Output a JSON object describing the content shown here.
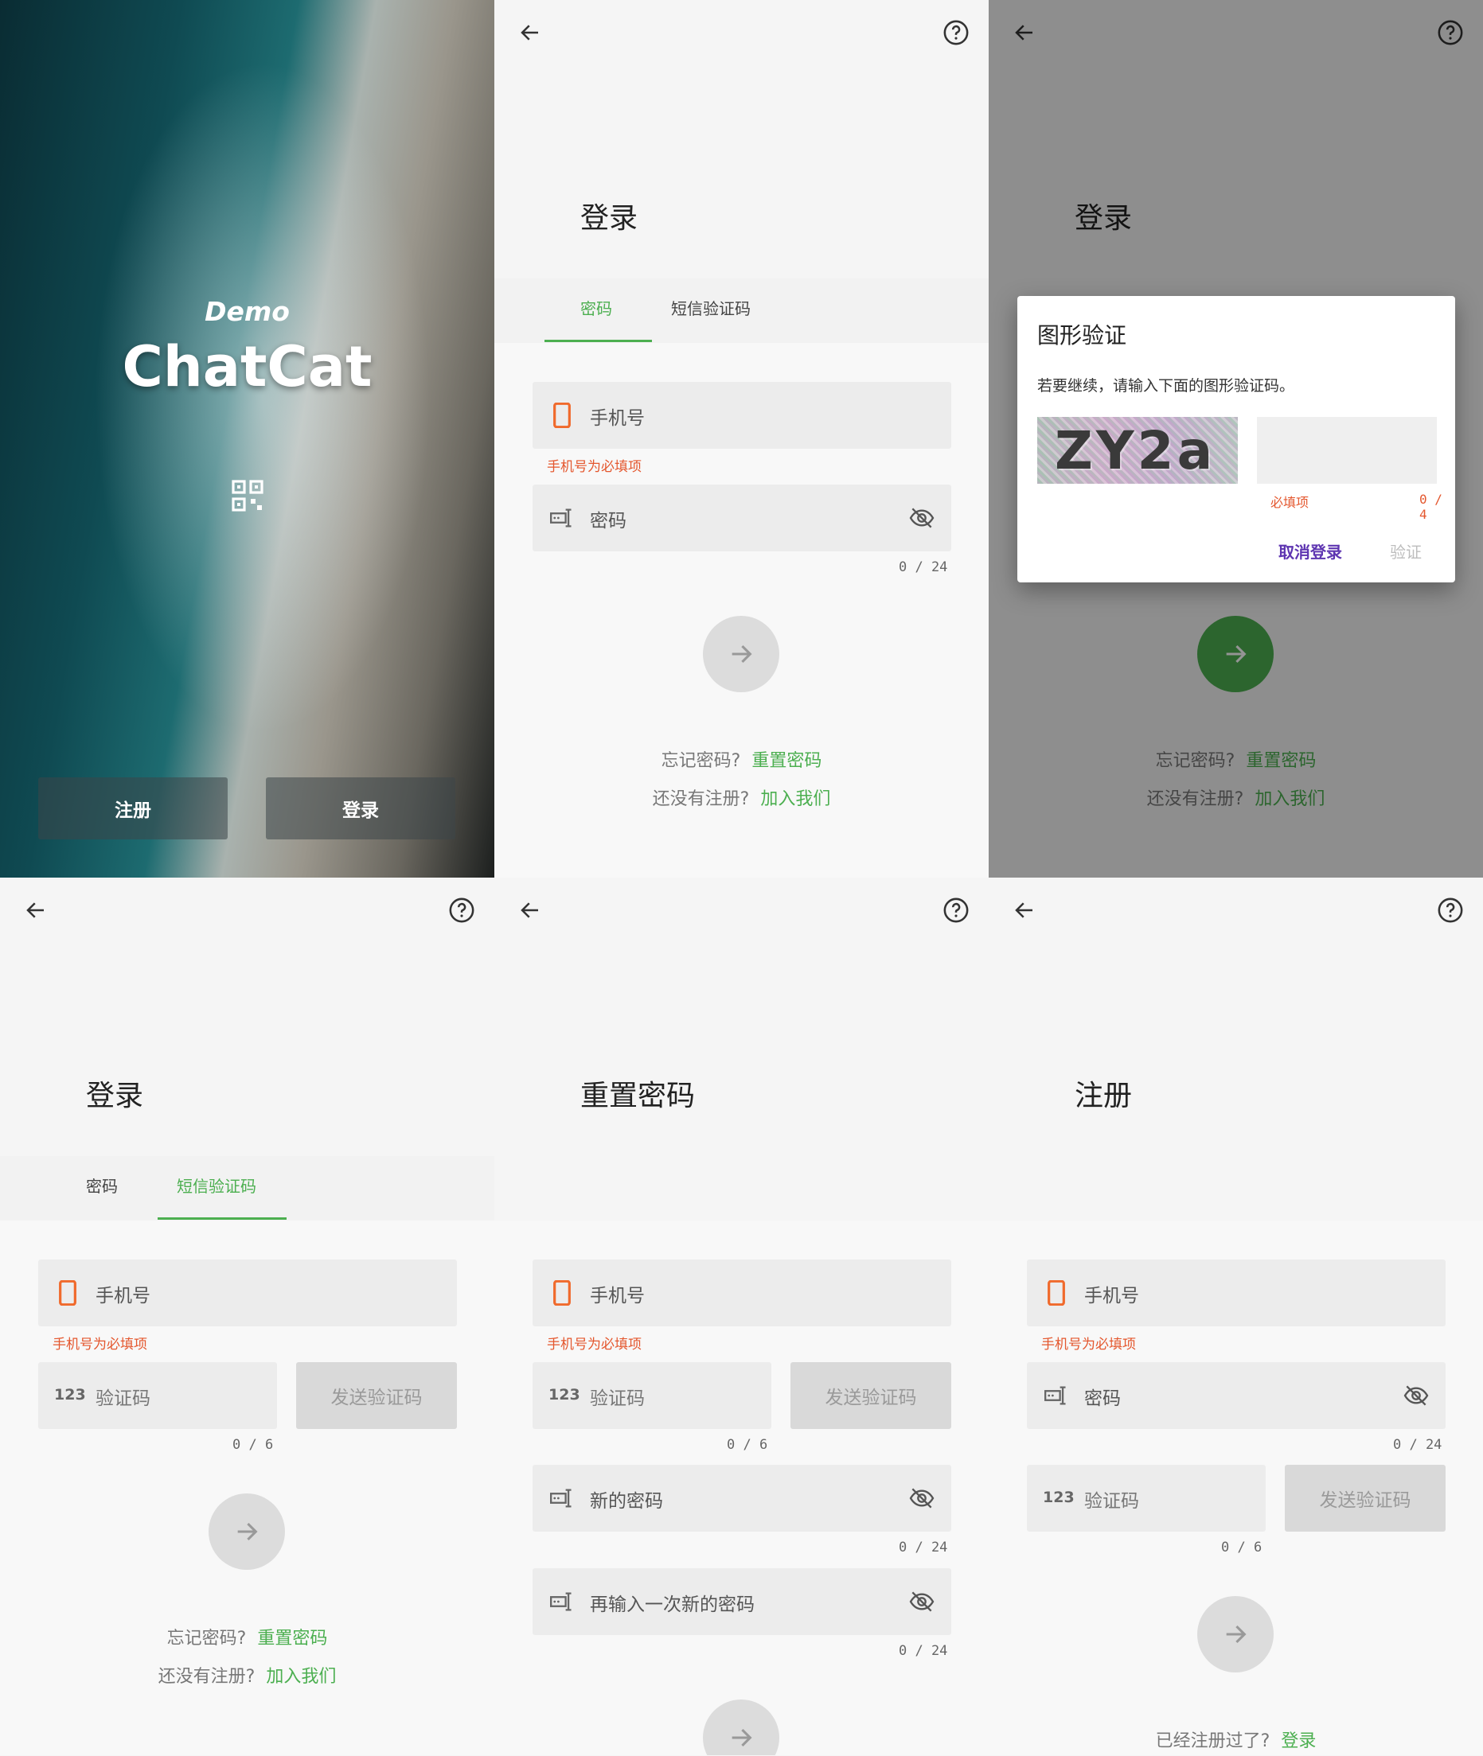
{
  "splash": {
    "demo": "Demo",
    "name": "ChatCat",
    "register_btn": "注册",
    "login_btn": "登录"
  },
  "login_password": {
    "title": "登录",
    "tab_password": "密码",
    "tab_sms": "短信验证码",
    "phone_label": "手机号",
    "phone_error": "手机号为必填项",
    "password_label": "密码",
    "password_counter": "0 / 24",
    "forgot_q": "忘记密码?",
    "forgot_link": "重置密码",
    "noreg_q": "还没有注册?",
    "noreg_link": "加入我们"
  },
  "captcha_dialog": {
    "page_title": "登录",
    "title": "图形验证",
    "message": "若要继续，请输入下面的图形验证码。",
    "captcha_text": "ZY2a",
    "error": "必填项",
    "counter": "0 / 4",
    "cancel": "取消登录",
    "verify": "验证",
    "forgot_q": "忘记密码?",
    "forgot_link": "重置密码",
    "noreg_q": "还没有注册?",
    "noreg_link": "加入我们"
  },
  "login_sms": {
    "title": "登录",
    "tab_password": "密码",
    "tab_sms": "短信验证码",
    "phone_label": "手机号",
    "phone_error": "手机号为必填项",
    "code_prefix": "123",
    "code_label": "验证码",
    "send_code": "发送验证码",
    "code_counter": "0 / 6",
    "forgot_q": "忘记密码?",
    "forgot_link": "重置密码",
    "noreg_q": "还没有注册?",
    "noreg_link": "加入我们"
  },
  "reset_password": {
    "title": "重置密码",
    "phone_label": "手机号",
    "phone_error": "手机号为必填项",
    "code_prefix": "123",
    "code_label": "验证码",
    "send_code": "发送验证码",
    "code_counter": "0 / 6",
    "new_password": "新的密码",
    "new_password_counter": "0 / 24",
    "repeat_password": "再输入一次新的密码",
    "repeat_password_counter": "0 / 24"
  },
  "register": {
    "title": "注册",
    "phone_label": "手机号",
    "phone_error": "手机号为必填项",
    "password_label": "密码",
    "password_counter": "0 / 24",
    "code_prefix": "123",
    "code_label": "验证码",
    "send_code": "发送验证码",
    "code_counter": "0 / 6",
    "already_q": "已经注册过了?",
    "login_link": "登录"
  },
  "colors": {
    "accent": "#4caf50",
    "error": "#e4572e",
    "phone_icon": "#f06a2c",
    "dialog_cancel": "#5e35b1",
    "fab_enabled": "#4caf50",
    "fab_disabled": "#dcdcdc"
  },
  "icons": {
    "back": "arrow-left-icon",
    "help": "help-circle-icon",
    "phone": "phone-icon",
    "password": "password-field-icon",
    "eye_off": "eye-off-icon",
    "next": "arrow-right-icon",
    "qr": "qr-code-icon"
  }
}
